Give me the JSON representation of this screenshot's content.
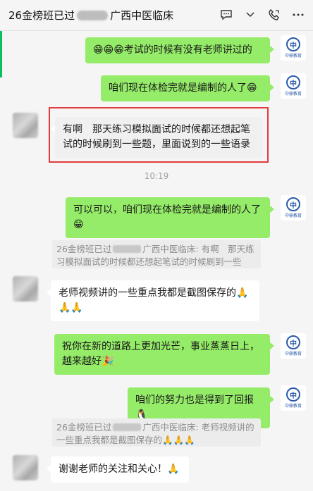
{
  "title": {
    "text_before": "26金榜班已过",
    "text_after": "广西中医临床"
  },
  "avatar_caption": "中鼎教育",
  "messages": [
    {
      "text": "😁😁😁考试的时候有没有老师讲过的"
    },
    {
      "text": "咱们现在体检完就是编制的人了😁"
    },
    {
      "text": "有啊　那天练习模拟面试的时候都还想起笔试的时候刷到一些题，里面说到的一些语录"
    },
    {
      "time": "10:19"
    },
    {
      "text": "可以可以，咱们现在体检完就是编制的人了😁"
    },
    {
      "quote_before": "26金榜班已过",
      "quote_after": "广西中医临床: 有啊　那天练习模拟面试的时候都还想起笔试的时候刷到一些题，里..."
    },
    {
      "text": "老师视频讲的一些重点我都是截图保存的🙏🙏🙏"
    },
    {
      "text": "祝你在新的道路上更加光芒，事业蒸蒸日上，越来越好🎉"
    },
    {
      "text": "咱们的努力也是得到了回报🐧"
    },
    {
      "quote_before": "26金榜班已过",
      "quote_after": "广西中医临床: 老师视频讲的一些重点我都是截图保存的🙏🙏🙏"
    },
    {
      "text": "谢谢老师的关注和关心！🙏"
    }
  ]
}
